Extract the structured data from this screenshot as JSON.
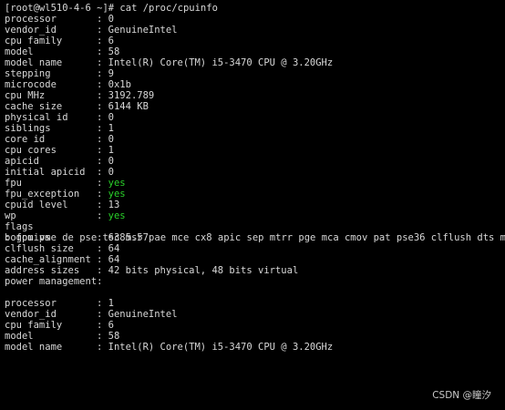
{
  "prompt_line": "[root@wl510-4-6 ~]# cat /proc/cpuinfo",
  "colors": {
    "green": "#2ad12a",
    "text": "#d8d8d8",
    "background": "#000000"
  },
  "separator": ": ",
  "block1": [
    {
      "key": "processor",
      "value": "0"
    },
    {
      "key": "vendor_id",
      "value": "GenuineIntel"
    },
    {
      "key": "cpu family",
      "value": "6"
    },
    {
      "key": "model",
      "value": "58"
    },
    {
      "key": "model name",
      "value": "Intel(R) Core(TM) i5-3470 CPU @ 3.20GHz"
    },
    {
      "key": "stepping",
      "value": "9"
    },
    {
      "key": "microcode",
      "value": "0x1b"
    },
    {
      "key": "cpu MHz",
      "value": "3192.789"
    },
    {
      "key": "cache size",
      "value": "6144 KB"
    },
    {
      "key": "physical id",
      "value": "0"
    },
    {
      "key": "siblings",
      "value": "1"
    },
    {
      "key": "core id",
      "value": "0"
    },
    {
      "key": "cpu cores",
      "value": "1"
    },
    {
      "key": "apicid",
      "value": "0"
    },
    {
      "key": "initial apicid",
      "value": "0"
    },
    {
      "key": "fpu",
      "value": "yes"
    },
    {
      "key": "fpu_exception",
      "value": "yes"
    },
    {
      "key": "cpuid level",
      "value": "13"
    },
    {
      "key": "wp",
      "value": "yes"
    }
  ],
  "flags_key": "flags",
  "flags_value": "fpu vme de pse tsc msr pae mce cx8 apic sep mtrr pge mca cmov pat pse36 clflush dts mmx fxsr sse sse2 ss syscall nx rdtscp lm constant_tsc arch_perfmon pebs bts nopl xtopology tsc_reliable nonstop_tsc aperfmperf eagerfpu pni pclmulqdq ssse3 cx16 pcid sse4_1 sse4_2 x2apic popcnt tsc_deadline_timer aes xsave avx f16c rdrand hypervisor lahf_lm epb fsgsbase tsc_adjust smep dtherm ida arat pln pts",
  "block1_tail": [
    {
      "key": "bogomips",
      "value": "6385.57"
    },
    {
      "key": "clflush size",
      "value": "64"
    },
    {
      "key": "cache_alignment",
      "value": "64"
    },
    {
      "key": "address sizes",
      "value": "42 bits physical, 48 bits virtual"
    },
    {
      "key": "power management",
      "value": ""
    }
  ],
  "block2": [
    {
      "key": "processor",
      "value": "1"
    },
    {
      "key": "vendor_id",
      "value": "GenuineIntel"
    },
    {
      "key": "cpu family",
      "value": "6"
    },
    {
      "key": "model",
      "value": "58"
    },
    {
      "key": "model name",
      "value": "Intel(R) Core(TM) i5-3470 CPU @ 3.20GHz"
    }
  ],
  "watermark": "CSDN @瞳汐"
}
